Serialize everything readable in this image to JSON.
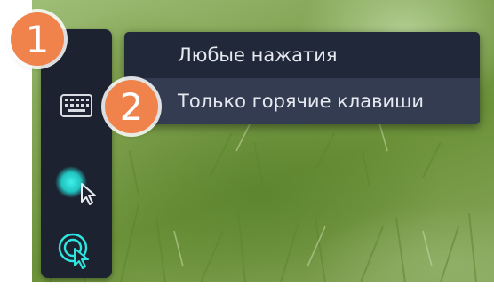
{
  "menu": {
    "items": [
      {
        "label": "Любые нажатия",
        "selected": false
      },
      {
        "label": "Только горячие клавиши",
        "selected": true
      }
    ]
  },
  "callouts": {
    "step1": "1",
    "step2": "2"
  },
  "toolbar": {
    "tools": [
      {
        "icon": "keyboard-icon"
      },
      {
        "icon": "cursor-highlight-icon"
      },
      {
        "icon": "click-effect-icon"
      }
    ]
  },
  "colors": {
    "toolbar_bg": "#1d2230",
    "menu_bg": "#21283a",
    "menu_selected_bg": "#343c52",
    "menu_text": "#e6e9f0",
    "accent_cyan": "#2ee6e0",
    "callout_orange": "#f0824c"
  }
}
